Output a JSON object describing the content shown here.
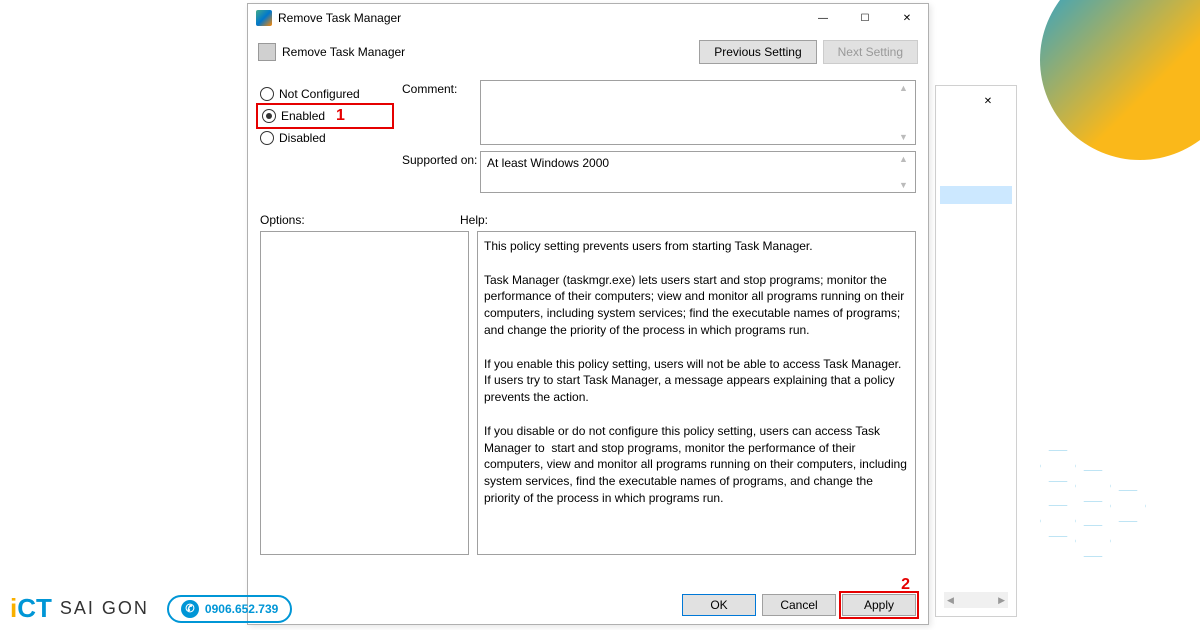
{
  "window": {
    "title": "Remove Task Manager",
    "subtitle": "Remove Task Manager",
    "nav": {
      "previous": "Previous Setting",
      "next": "Next Setting"
    }
  },
  "radios": {
    "not_configured": "Not Configured",
    "enabled": "Enabled",
    "disabled": "Disabled"
  },
  "fields": {
    "comment_label": "Comment:",
    "comment_value": "",
    "supported_label": "Supported on:",
    "supported_value": "At least Windows 2000"
  },
  "sections": {
    "options_label": "Options:",
    "help_label": "Help:"
  },
  "help_text": "This policy setting prevents users from starting Task Manager.\n\nTask Manager (taskmgr.exe) lets users start and stop programs; monitor the performance of their computers; view and monitor all programs running on their computers, including system services; find the executable names of programs; and change the priority of the process in which programs run.\n\nIf you enable this policy setting, users will not be able to access Task Manager. If users try to start Task Manager, a message appears explaining that a policy prevents the action.\n\nIf you disable or do not configure this policy setting, users can access Task Manager to  start and stop programs, monitor the performance of their computers, view and monitor all programs running on their computers, including system services, find the executable names of programs, and change the priority of the process in which programs run.",
  "buttons": {
    "ok": "OK",
    "cancel": "Cancel",
    "apply": "Apply"
  },
  "annotations": {
    "one": "1",
    "two": "2"
  },
  "branding": {
    "logo_text": "SAI GON",
    "phone": "0906.652.739"
  }
}
